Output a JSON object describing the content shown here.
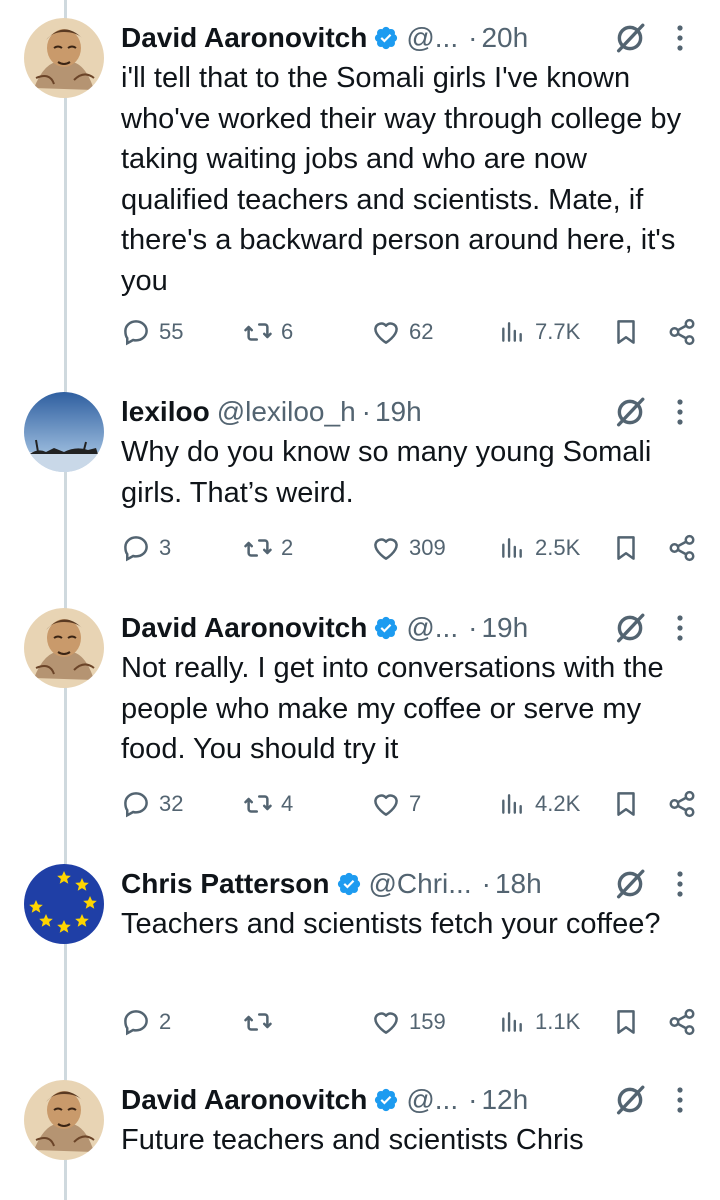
{
  "tweets": [
    {
      "name": "David Aaronovitch",
      "handle": "@...",
      "verified": true,
      "time": "20h",
      "text": "i'll tell that to the Somali girls I've known who've worked their way through college by taking waiting jobs and who are now qualified teachers and scientists. Mate, if there's a backward person around here, it's you",
      "replies": "55",
      "reposts": "6",
      "likes": "62",
      "views": "7.7K",
      "avatar": "sketch-portrait"
    },
    {
      "name": "lexiloo",
      "handle": "@lexiloo_h",
      "verified": false,
      "time": "19h",
      "text": "Why do you know so many young Somali girls. That’s weird.",
      "replies": "3",
      "reposts": "2",
      "likes": "309",
      "views": "2.5K",
      "avatar": "sky-landscape"
    },
    {
      "name": "David Aaronovitch",
      "handle": "@...",
      "verified": true,
      "time": "19h",
      "text": "Not really. I get into conversations with the people who make my coffee or serve my food. You should try it",
      "replies": "32",
      "reposts": "4",
      "likes": "7",
      "views": "4.2K",
      "avatar": "sketch-portrait"
    },
    {
      "name": "Chris Patterson",
      "handle": "@Chri...",
      "verified": true,
      "time": "18h",
      "text": "Teachers and scientists fetch your coffee?",
      "replies": "2",
      "reposts": "",
      "likes": "159",
      "views": "1.1K",
      "avatar": "eu-flag"
    },
    {
      "name": "David Aaronovitch",
      "handle": "@...",
      "verified": true,
      "time": "12h",
      "text": "Future teachers and scientists Chris",
      "avatar": "sketch-portrait"
    }
  ],
  "separator": "·",
  "colors": {
    "verified": "#1d9bf0",
    "secondary_text": "#536471",
    "primary_text": "#0f1419",
    "thread_line": "#cfd9de",
    "eu_blue": "#1f3fa6",
    "eu_star": "#ffd500"
  },
  "icons": {
    "verified": "verified-badge-icon",
    "grok": "grok-icon",
    "more": "more-vertical-icon",
    "reply": "reply-icon",
    "repost": "repost-icon",
    "like": "heart-icon",
    "views": "views-icon",
    "bookmark": "bookmark-icon",
    "share": "share-icon"
  }
}
